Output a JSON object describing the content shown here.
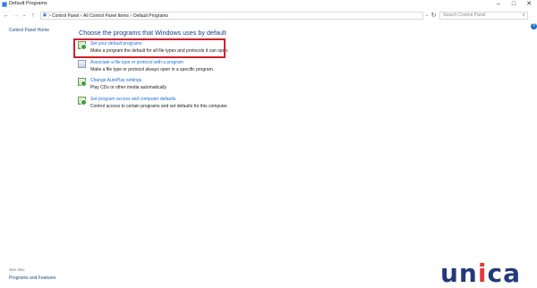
{
  "window": {
    "title": "Default Programs"
  },
  "window_controls": {
    "minimize": "–",
    "maximize": "□",
    "close": "✕"
  },
  "nav": {
    "back": "←",
    "forward": "→",
    "recent": "⌄",
    "up": "↑",
    "refresh": "↻",
    "dropdown": "⌄"
  },
  "address": {
    "breadcrumbs": [
      "Control Panel",
      "All Control Panel Items",
      "Default Programs"
    ],
    "separator": ">"
  },
  "search": {
    "placeholder": "Search Control Panel",
    "icon": "search-icon"
  },
  "help": {
    "label": "?"
  },
  "left_pane": {
    "home": "Control Panel Home",
    "see_also_label": "See also",
    "see_also_link": "Programs and Features"
  },
  "main": {
    "heading": "Choose the programs that Windows uses by default",
    "tasks": [
      {
        "link": "Set your default programs",
        "desc": "Make a program the default for all file types and protocols it can open."
      },
      {
        "link": "Associate a file type or protocol with a program",
        "desc": "Make a file type or protocol always open in a specific program."
      },
      {
        "link": "Change AutoPlay settings",
        "desc": "Play CDs or other media automatically"
      },
      {
        "link": "Set program access and computer defaults",
        "desc": "Control access to certain programs and set defaults for this computer."
      }
    ]
  },
  "watermark": {
    "logo_prefix": "un",
    "logo_accent": "i",
    "logo_suffix": "ca"
  },
  "colors": {
    "highlight": "#d21f2e",
    "link": "#1e6fd0",
    "heading": "#1e3a8a"
  }
}
